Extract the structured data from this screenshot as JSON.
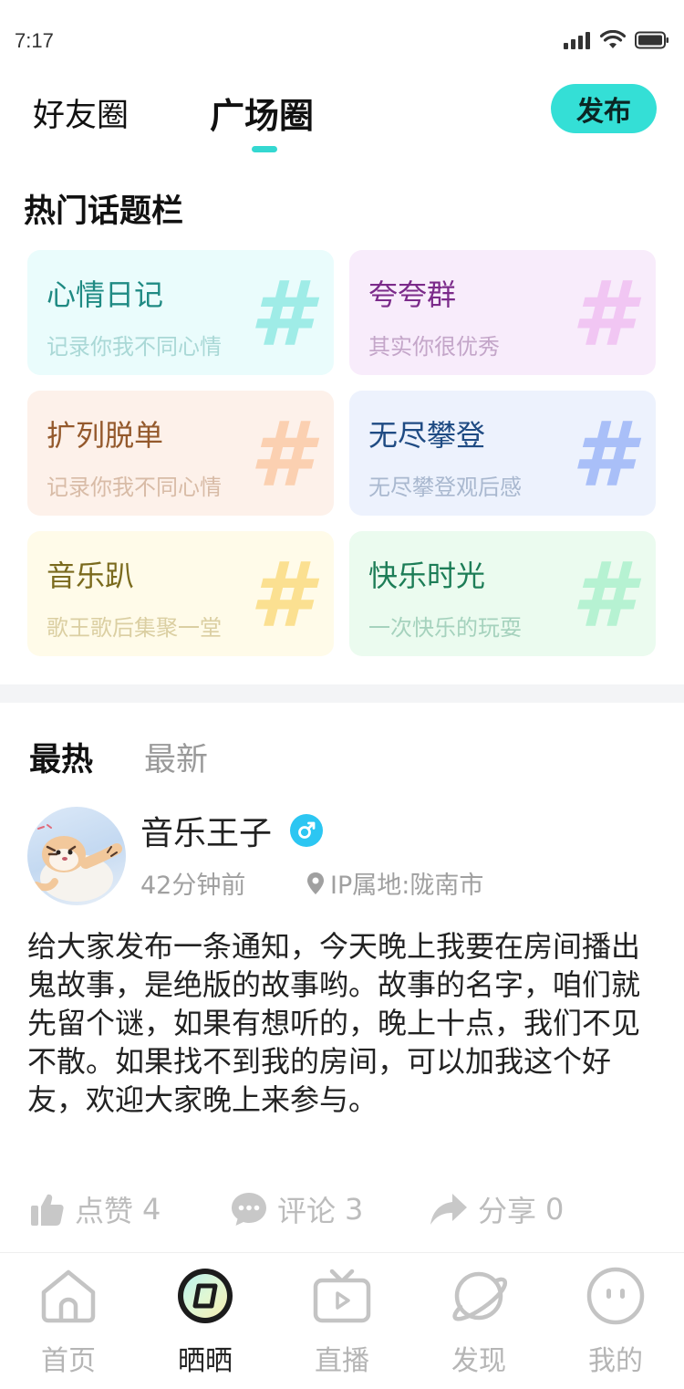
{
  "status_bar": {
    "time": "7:17"
  },
  "header": {
    "tabs": [
      {
        "label": "好友圈",
        "active": false
      },
      {
        "label": "广场圈",
        "active": true
      }
    ],
    "publish_label": "发布",
    "accent_color": "#34dfd6"
  },
  "topics_section": {
    "title": "热门话题栏",
    "cards": [
      {
        "title": "心情日记",
        "subtitle": "记录你我不同心情",
        "hash": "#",
        "bg": "#eafcfc",
        "title_color": "#1f8a83",
        "sub_color": "#a9d8d6",
        "hash_color": "#9fece7"
      },
      {
        "title": "夸夸群",
        "subtitle": "其实你很优秀",
        "hash": "#",
        "bg": "#f8ecfb",
        "title_color": "#7b2a8a",
        "sub_color": "#c4a6c9",
        "hash_color": "#f1c6f3"
      },
      {
        "title": "扩列脱单",
        "subtitle": "记录你我不同心情",
        "hash": "#",
        "bg": "#fdf1ea",
        "title_color": "#94592c",
        "sub_color": "#d8bba6",
        "hash_color": "#fbd0b1"
      },
      {
        "title": "无尽攀登",
        "subtitle": "无尽攀登观后感",
        "hash": "#",
        "bg": "#edf2fd",
        "title_color": "#1f4b83",
        "sub_color": "#a9b8cf",
        "hash_color": "#a9bff8"
      },
      {
        "title": "音乐趴",
        "subtitle": "歌王歌后集聚一堂",
        "hash": "#",
        "bg": "#fffbe9",
        "title_color": "#7a6a1d",
        "sub_color": "#dbcfa2",
        "hash_color": "#fbe091"
      },
      {
        "title": "快乐时光",
        "subtitle": "一次快乐的玩耍",
        "hash": "#",
        "bg": "#ebfbef",
        "title_color": "#1d7d57",
        "sub_color": "#a5d2bd",
        "hash_color": "#b6f2d2"
      }
    ]
  },
  "feed": {
    "sort_tabs": [
      {
        "label": "最热",
        "active": true
      },
      {
        "label": "最新",
        "active": false
      }
    ],
    "post": {
      "username": "音乐王子",
      "gender_icon": "male-icon",
      "time": "42分钟前",
      "location": "IP属地:陇南市",
      "content": "给大家发布一条通知，今天晚上我要在房间播出鬼故事，是绝版的故事哟。故事的名字，咱们就先留个谜，如果有想听的，晚上十点，我们不见不散。如果找不到我的房间，可以加我这个好友，欢迎大家晚上来参与。",
      "actions": [
        {
          "icon": "thumbs-up-icon",
          "label": "点赞",
          "count": "4"
        },
        {
          "icon": "comment-icon",
          "label": "评论",
          "count": "3"
        },
        {
          "icon": "share-icon",
          "label": "分享",
          "count": "0"
        }
      ]
    }
  },
  "bottom_nav": [
    {
      "label": "首页",
      "icon": "home-icon",
      "active": false
    },
    {
      "label": "晒晒",
      "icon": "shaishai-icon",
      "active": true
    },
    {
      "label": "直播",
      "icon": "tv-icon",
      "active": false
    },
    {
      "label": "发现",
      "icon": "planet-icon",
      "active": false
    },
    {
      "label": "我的",
      "icon": "profile-icon",
      "active": false
    }
  ]
}
